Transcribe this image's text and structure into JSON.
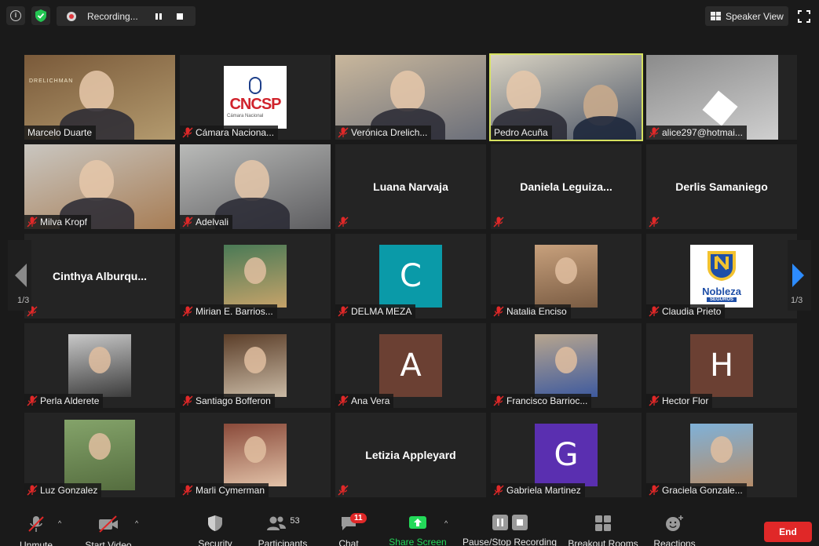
{
  "topbar": {
    "recording_label": "Recording...",
    "view_label": "Speaker View"
  },
  "participants": [
    {
      "name": "Marcelo Duarte",
      "muted": false,
      "kind": "video"
    },
    {
      "name": "Cámara Naciona...",
      "muted": true,
      "kind": "logo-cncsp"
    },
    {
      "name": "Verónica Drelich...",
      "muted": true,
      "kind": "video"
    },
    {
      "name": "Pedro Acuña",
      "muted": false,
      "kind": "video",
      "active": true
    },
    {
      "name": "alice297@hotmai...",
      "muted": true,
      "kind": "video"
    },
    {
      "name": "Milva Kropf",
      "muted": true,
      "kind": "video"
    },
    {
      "name": "Adelvali",
      "muted": true,
      "kind": "video"
    },
    {
      "name": "Luana Narvaja",
      "muted": true,
      "kind": "name"
    },
    {
      "name": "Daniela  Leguiza...",
      "muted": true,
      "kind": "name"
    },
    {
      "name": "Derlis Samaniego",
      "muted": true,
      "kind": "name"
    },
    {
      "name": "Cinthya  Alburqu...",
      "muted": true,
      "kind": "name"
    },
    {
      "name": "Mirian E. Barrios...",
      "muted": true,
      "kind": "photo"
    },
    {
      "name": "DELMA MEZA",
      "muted": true,
      "kind": "letter",
      "letter": "C",
      "color": "#0a9aa8"
    },
    {
      "name": "Natalia Enciso",
      "muted": true,
      "kind": "photo"
    },
    {
      "name": "Claudia Prieto",
      "muted": true,
      "kind": "logo-nobleza"
    },
    {
      "name": "Perla Alderete",
      "muted": true,
      "kind": "photo"
    },
    {
      "name": "Santiago Bofferon",
      "muted": true,
      "kind": "photo"
    },
    {
      "name": "Ana Vera",
      "muted": true,
      "kind": "letter",
      "letter": "A",
      "color": "#6b4033"
    },
    {
      "name": "Francisco Barrioc...",
      "muted": true,
      "kind": "photo"
    },
    {
      "name": "Hector Flor",
      "muted": true,
      "kind": "letter",
      "letter": "H",
      "color": "#6b4033"
    },
    {
      "name": "Luz Gonzalez",
      "muted": true,
      "kind": "photo"
    },
    {
      "name": "Marli Cymerman",
      "muted": true,
      "kind": "photo"
    },
    {
      "name": "Letizia Appleyard",
      "muted": true,
      "kind": "name"
    },
    {
      "name": "Gabriela Martinez",
      "muted": true,
      "kind": "letter",
      "letter": "G",
      "color": "#5a2fb0"
    },
    {
      "name": "Graciela Gonzale...",
      "muted": true,
      "kind": "photo"
    }
  ],
  "logos": {
    "cncsp_text": "CNCSP",
    "cncsp_sub": "Cámara Nacional",
    "nobleza_text": "Nobleza",
    "nobleza_sub": "SEGUROS",
    "drelichman_text": "DRELICHMAN"
  },
  "pagination": {
    "left": "1/3",
    "right": "1/3"
  },
  "toolbar": {
    "unmute": "Unmute",
    "start_video": "Start Video",
    "security": "Security",
    "participants": "Participants",
    "participants_count": "53",
    "chat": "Chat",
    "chat_badge": "11",
    "share_screen": "Share Screen",
    "recording": "Pause/Stop Recording",
    "breakout": "Breakout Rooms",
    "reactions": "Reactions",
    "end": "End"
  },
  "colors": {
    "accent_active": "#d6e15f",
    "share_green": "#23d959",
    "end_red": "#e02828",
    "nav_blue": "#2d8cff"
  }
}
